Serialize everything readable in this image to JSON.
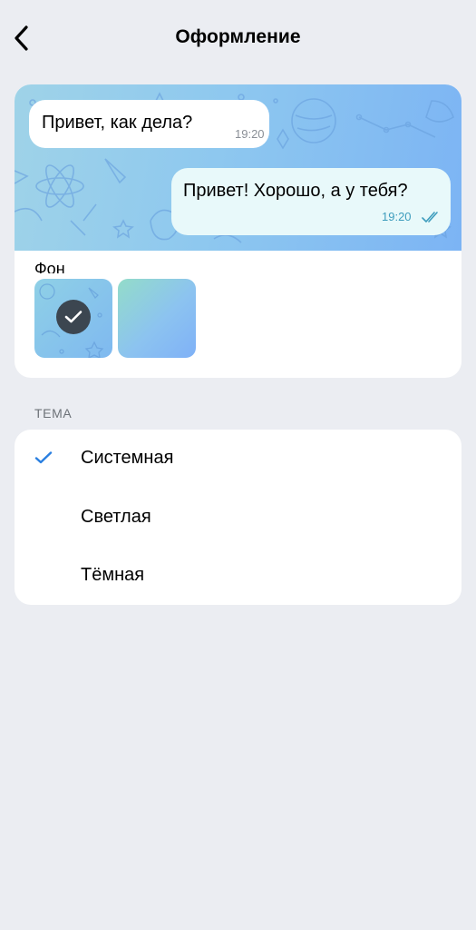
{
  "header": {
    "title": "Оформление"
  },
  "preview": {
    "incoming": {
      "text": "Привет, как дела?",
      "time": "19:20"
    },
    "outgoing": {
      "text": "Привет! Хорошо, а у тебя?",
      "time": "19:20"
    },
    "section_partial": "Фон"
  },
  "wallpapers": {
    "selected_index": 0
  },
  "theme": {
    "section_label": "ТЕМА",
    "options": [
      {
        "label": "Системная",
        "selected": true
      },
      {
        "label": "Светлая",
        "selected": false
      },
      {
        "label": "Тёмная",
        "selected": false
      }
    ],
    "accent": "#2a7fe0"
  },
  "colors": {
    "background": "#ebedf2",
    "card": "#ffffff",
    "outgoing_bubble": "#e8f9fa",
    "wallpaper_from": "#9fd3e8",
    "wallpaper_to": "#7cb4f4"
  }
}
